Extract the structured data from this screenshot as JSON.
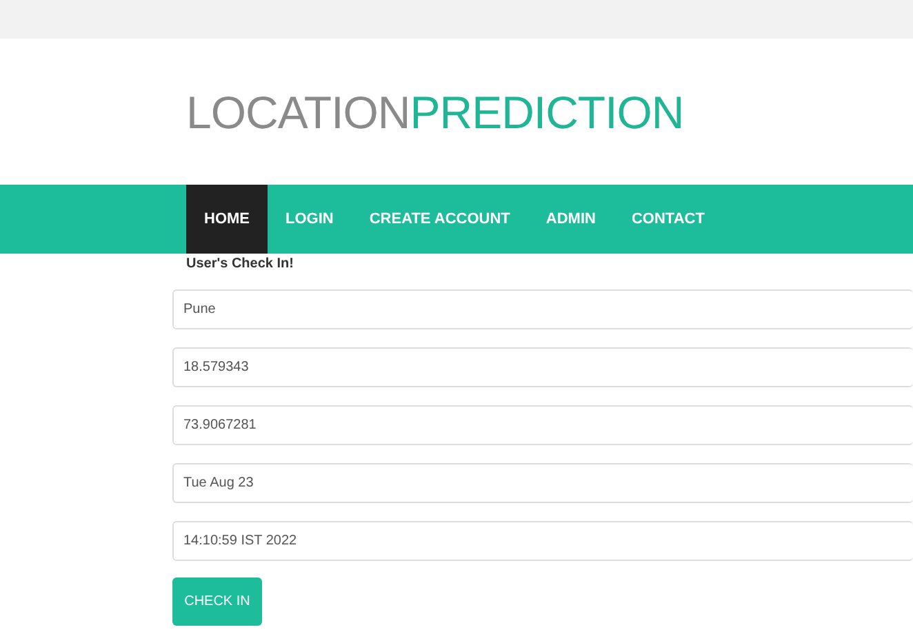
{
  "logo": {
    "part_1": "LOCATION",
    "part_2": "PREDICTION"
  },
  "nav": [
    {
      "label": "HOME",
      "selected": true
    },
    {
      "label": "LOGIN",
      "selected": false
    },
    {
      "label": "CREATE ACCOUNT",
      "selected": false
    },
    {
      "label": "ADMIN",
      "selected": false
    },
    {
      "label": "CONTACT",
      "selected": false
    }
  ],
  "form": {
    "heading": "User's Check In!",
    "fields": [
      {
        "value": "Pune"
      },
      {
        "value": "18.579343"
      },
      {
        "value": "73.9067281"
      },
      {
        "value": "Tue Aug 23"
      },
      {
        "value": "14:10:59 IST 2022"
      }
    ],
    "button": "CHECK IN"
  }
}
